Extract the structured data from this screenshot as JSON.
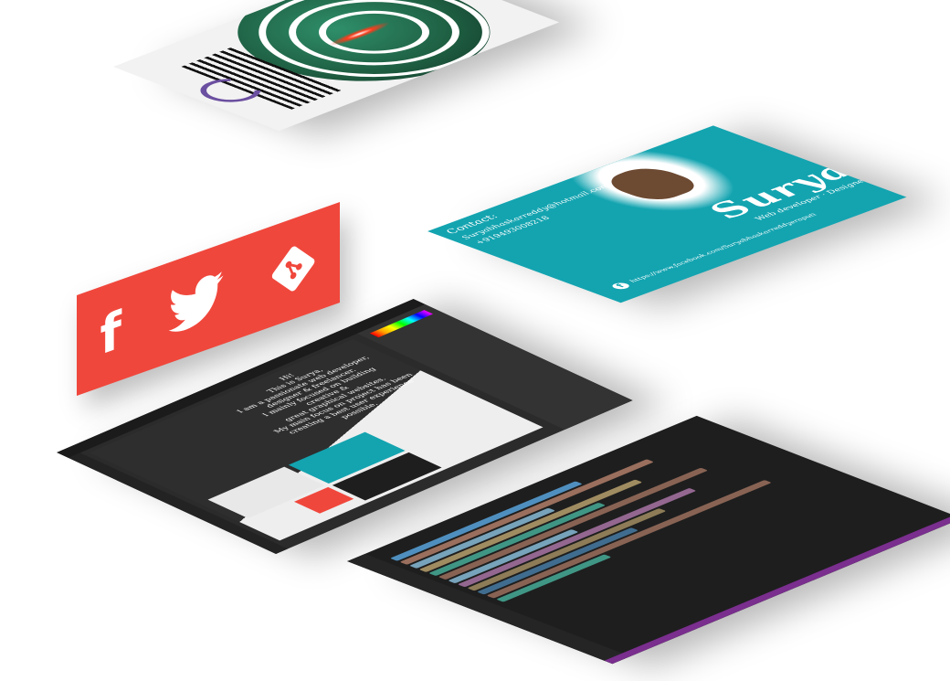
{
  "bio": {
    "greeting": "Hi!",
    "lines": [
      "This is Surya,",
      "I am a passionate web developer,",
      "designer & freelancer.",
      "I mainly focused on building",
      "creative &",
      "great graphical websites.",
      "My main focus on project has been",
      "creating a best user experience",
      "possible."
    ]
  },
  "business_card": {
    "contact_label": "Contact:",
    "email": "Suryabhaskarreddy@hotmail.com",
    "phone": "+919493008218",
    "facebook_url": "https://www.facebook.com/Suryabhaskarreddyeraputi",
    "name": "Surya",
    "tagline": "Web developer · Designer"
  },
  "social": {
    "icons": [
      "facebook-icon",
      "twitter-icon",
      "git-icon"
    ]
  },
  "colors": {
    "teal": "#13a4b0",
    "red": "#f0473c",
    "dark": "#2b2b2b",
    "editor_bg": "#1e1e1e",
    "editor_accent": "#7a2e8e"
  }
}
